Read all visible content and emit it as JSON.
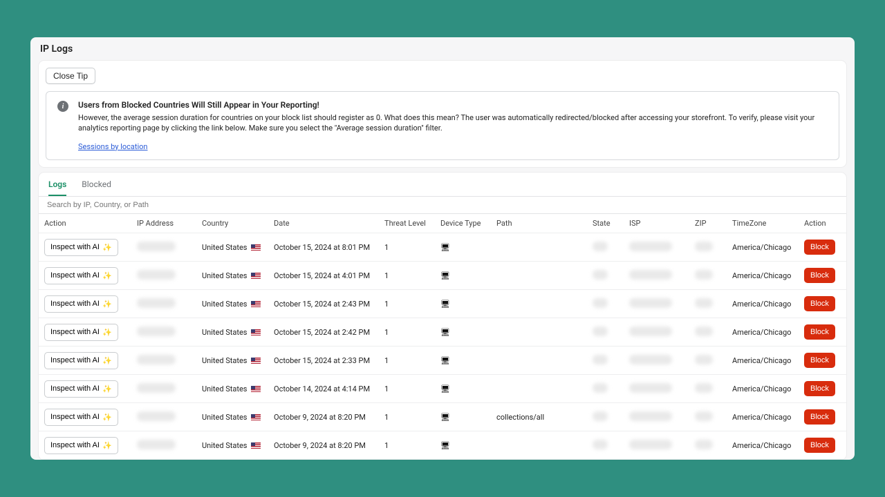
{
  "page": {
    "title": "IP Logs"
  },
  "tip": {
    "close_label": "Close Tip",
    "title": "Users from Blocked Countries Will Still Appear in Your Reporting!",
    "body": "However, the average session duration for countries on your block list should register as 0. What does this mean? The user was automatically redirected/blocked after accessing your storefront. To verify, please visit your analytics reporting page by clicking the link below. Make sure you select the \"Average session duration\" filter.",
    "link_label": "Sessions by location"
  },
  "tabs": [
    {
      "label": "Logs",
      "active": true
    },
    {
      "label": "Blocked",
      "active": false
    }
  ],
  "search": {
    "placeholder": "Search by IP, Country, or Path"
  },
  "columns": [
    "Action",
    "IP Address",
    "Country",
    "Date",
    "Threat Level",
    "Device Type",
    "Path",
    "State",
    "ISP",
    "ZIP",
    "TimeZone",
    "Action"
  ],
  "buttons": {
    "inspect": "Inspect with AI",
    "block": "Block"
  },
  "country_label": "United States",
  "rows": [
    {
      "date": "October 15, 2024 at 8:01 PM",
      "threat": "1",
      "path": "",
      "tz": "America/Chicago"
    },
    {
      "date": "October 15, 2024 at 4:01 PM",
      "threat": "1",
      "path": "",
      "tz": "America/Chicago"
    },
    {
      "date": "October 15, 2024 at 2:43 PM",
      "threat": "1",
      "path": "",
      "tz": "America/Chicago"
    },
    {
      "date": "October 15, 2024 at 2:42 PM",
      "threat": "1",
      "path": "",
      "tz": "America/Chicago"
    },
    {
      "date": "October 15, 2024 at 2:33 PM",
      "threat": "1",
      "path": "",
      "tz": "America/Chicago"
    },
    {
      "date": "October 14, 2024 at 4:14 PM",
      "threat": "1",
      "path": "",
      "tz": "America/Chicago"
    },
    {
      "date": "October 9, 2024 at 8:20 PM",
      "threat": "1",
      "path": "collections/all",
      "tz": "America/Chicago"
    },
    {
      "date": "October 9, 2024 at 8:20 PM",
      "threat": "1",
      "path": "",
      "tz": "America/Chicago"
    }
  ]
}
